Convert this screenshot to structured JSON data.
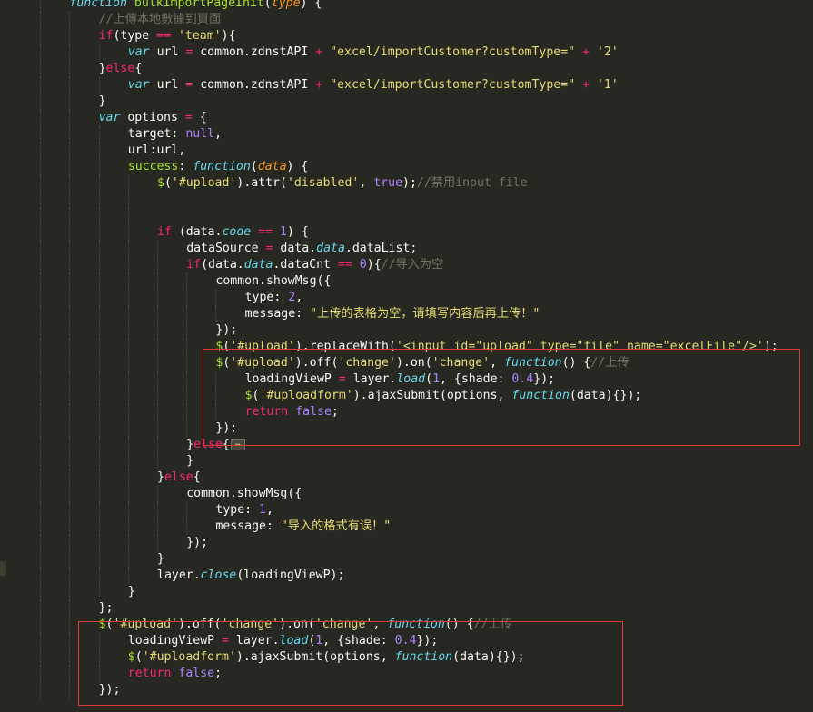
{
  "editor": {
    "theme": "Monokai",
    "colors": {
      "background": "#272822",
      "keyword": "#f92672",
      "storage": "#66d9ef",
      "function_name": "#a6e22e",
      "string": "#e6db74",
      "number": "#ae81ff",
      "comment": "#75715e",
      "parameter": "#fd971f",
      "text": "#f8f8f2",
      "highlight_box": "#d93a3a"
    },
    "lines": [
      {
        "indent": 2,
        "tokens": [
          [
            "st",
            "function"
          ],
          [
            "pl",
            " "
          ],
          [
            "fn",
            "bulkImportPageInit"
          ],
          [
            "pl",
            "("
          ],
          [
            "par",
            "type"
          ],
          [
            "pl",
            ") {"
          ]
        ]
      },
      {
        "indent": 3,
        "tokens": [
          [
            "cm",
            "//上傳本地數據到頁面"
          ]
        ]
      },
      {
        "indent": 3,
        "tokens": [
          [
            "kw",
            "if"
          ],
          [
            "pl",
            "(type "
          ],
          [
            "kw",
            "=="
          ],
          [
            "pl",
            " "
          ],
          [
            "str",
            "'team'"
          ],
          [
            "pl",
            "){"
          ]
        ]
      },
      {
        "indent": 4,
        "tokens": [
          [
            "st",
            "var"
          ],
          [
            "pl",
            " url "
          ],
          [
            "kw",
            "="
          ],
          [
            "pl",
            " common.zdnstAPI "
          ],
          [
            "kw",
            "+"
          ],
          [
            "pl",
            " "
          ],
          [
            "str",
            "\"excel/importCustomer?customType=\""
          ],
          [
            "pl",
            " "
          ],
          [
            "kw",
            "+"
          ],
          [
            "pl",
            " "
          ],
          [
            "str",
            "'2'"
          ]
        ]
      },
      {
        "indent": 3,
        "tokens": [
          [
            "pl",
            "}"
          ],
          [
            "kw",
            "else"
          ],
          [
            "pl",
            "{"
          ]
        ]
      },
      {
        "indent": 4,
        "tokens": [
          [
            "st",
            "var"
          ],
          [
            "pl",
            " url "
          ],
          [
            "kw",
            "="
          ],
          [
            "pl",
            " common.zdnstAPI "
          ],
          [
            "kw",
            "+"
          ],
          [
            "pl",
            " "
          ],
          [
            "str",
            "\"excel/importCustomer?customType=\""
          ],
          [
            "pl",
            " "
          ],
          [
            "kw",
            "+"
          ],
          [
            "pl",
            " "
          ],
          [
            "str",
            "'1'"
          ]
        ]
      },
      {
        "indent": 3,
        "tokens": [
          [
            "pl",
            "}"
          ]
        ]
      },
      {
        "indent": 3,
        "tokens": [
          [
            "st",
            "var"
          ],
          [
            "pl",
            " options "
          ],
          [
            "kw",
            "="
          ],
          [
            "pl",
            " {"
          ]
        ]
      },
      {
        "indent": 4,
        "tokens": [
          [
            "pl",
            "target: "
          ],
          [
            "num",
            "null"
          ],
          [
            "pl",
            ","
          ]
        ]
      },
      {
        "indent": 4,
        "tokens": [
          [
            "pl",
            "url:url,"
          ]
        ]
      },
      {
        "indent": 4,
        "tokens": [
          [
            "fn",
            "success"
          ],
          [
            "pl",
            ": "
          ],
          [
            "st",
            "function"
          ],
          [
            "pl",
            "("
          ],
          [
            "par",
            "data"
          ],
          [
            "pl",
            ") {"
          ]
        ]
      },
      {
        "indent": 5,
        "tokens": [
          [
            "fn",
            "$"
          ],
          [
            "pl",
            "("
          ],
          [
            "str",
            "'#upload'"
          ],
          [
            "pl",
            ").attr("
          ],
          [
            "str",
            "'disabled'"
          ],
          [
            "pl",
            ", "
          ],
          [
            "num",
            "true"
          ],
          [
            "pl",
            ");"
          ],
          [
            "cm",
            "//禁用input file"
          ]
        ]
      },
      {
        "indent": 5,
        "tokens": []
      },
      {
        "indent": 5,
        "tokens": []
      },
      {
        "indent": 5,
        "tokens": [
          [
            "kw",
            "if"
          ],
          [
            "pl",
            " (data."
          ],
          [
            "st",
            "code"
          ],
          [
            "pl",
            " "
          ],
          [
            "kw",
            "=="
          ],
          [
            "pl",
            " "
          ],
          [
            "num",
            "1"
          ],
          [
            "pl",
            ") {"
          ]
        ]
      },
      {
        "indent": 6,
        "tokens": [
          [
            "pl",
            "dataSource "
          ],
          [
            "kw",
            "="
          ],
          [
            "pl",
            " data."
          ],
          [
            "st",
            "data"
          ],
          [
            "pl",
            ".dataList;"
          ]
        ]
      },
      {
        "indent": 6,
        "tokens": [
          [
            "kw",
            "if"
          ],
          [
            "pl",
            "(data."
          ],
          [
            "st",
            "data"
          ],
          [
            "pl",
            ".dataCnt "
          ],
          [
            "kw",
            "=="
          ],
          [
            "pl",
            " "
          ],
          [
            "num",
            "0"
          ],
          [
            "pl",
            "){"
          ],
          [
            "cm",
            "//导入为空"
          ]
        ]
      },
      {
        "indent": 7,
        "tokens": [
          [
            "pl",
            "common.showMsg({"
          ]
        ]
      },
      {
        "indent": 8,
        "tokens": [
          [
            "pl",
            "type: "
          ],
          [
            "num",
            "2"
          ],
          [
            "pl",
            ","
          ]
        ]
      },
      {
        "indent": 8,
        "tokens": [
          [
            "pl",
            "message: "
          ],
          [
            "str",
            "\"上传的表格为空，请填写内容后再上传！\""
          ]
        ]
      },
      {
        "indent": 7,
        "tokens": [
          [
            "pl",
            "});"
          ]
        ]
      },
      {
        "indent": 7,
        "tokens": [
          [
            "fn",
            "$"
          ],
          [
            "pl",
            "("
          ],
          [
            "str",
            "'#upload'"
          ],
          [
            "pl",
            ").replaceWith("
          ],
          [
            "str",
            "'<input id=\"upload\" type=\"file\" name=\"excelFile\"/>'"
          ],
          [
            "pl",
            ");"
          ]
        ]
      },
      {
        "indent": 7,
        "tokens": [
          [
            "fn",
            "$"
          ],
          [
            "pl",
            "("
          ],
          [
            "str",
            "'#upload'"
          ],
          [
            "pl",
            ").off("
          ],
          [
            "str",
            "'change'"
          ],
          [
            "pl",
            ").on("
          ],
          [
            "str",
            "'change'"
          ],
          [
            "pl",
            ", "
          ],
          [
            "st",
            "function"
          ],
          [
            "pl",
            "() {"
          ],
          [
            "cm",
            "//上传"
          ]
        ]
      },
      {
        "indent": 8,
        "tokens": [
          [
            "pl",
            "loadingViewP "
          ],
          [
            "kw",
            "="
          ],
          [
            "pl",
            " layer."
          ],
          [
            "st",
            "load"
          ],
          [
            "pl",
            "("
          ],
          [
            "num",
            "1"
          ],
          [
            "pl",
            ", {shade: "
          ],
          [
            "num",
            "0.4"
          ],
          [
            "pl",
            "});"
          ]
        ]
      },
      {
        "indent": 8,
        "tokens": [
          [
            "fn",
            "$"
          ],
          [
            "pl",
            "("
          ],
          [
            "str",
            "'#uploadform'"
          ],
          [
            "pl",
            ").ajaxSubmit(options, "
          ],
          [
            "st",
            "function"
          ],
          [
            "pl",
            "(data){});"
          ]
        ]
      },
      {
        "indent": 8,
        "tokens": [
          [
            "kw",
            "return"
          ],
          [
            "pl",
            " "
          ],
          [
            "num",
            "false"
          ],
          [
            "pl",
            ";"
          ]
        ]
      },
      {
        "indent": 7,
        "tokens": [
          [
            "pl",
            "});"
          ]
        ]
      },
      {
        "indent": 6,
        "tokens": [
          [
            "pl",
            "}"
          ],
          [
            "kw",
            "else"
          ],
          [
            "pl",
            "{"
          ]
        ],
        "fold": true
      },
      {
        "indent": 6,
        "tokens": [
          [
            "pl",
            "}"
          ]
        ]
      },
      {
        "indent": 5,
        "tokens": [
          [
            "pl",
            "}"
          ],
          [
            "kw",
            "else"
          ],
          [
            "pl",
            "{"
          ]
        ]
      },
      {
        "indent": 6,
        "tokens": [
          [
            "pl",
            "common.showMsg({"
          ]
        ]
      },
      {
        "indent": 7,
        "tokens": [
          [
            "pl",
            "type: "
          ],
          [
            "num",
            "1"
          ],
          [
            "pl",
            ","
          ]
        ]
      },
      {
        "indent": 7,
        "tokens": [
          [
            "pl",
            "message: "
          ],
          [
            "str",
            "\"导入的格式有误！\""
          ]
        ]
      },
      {
        "indent": 6,
        "tokens": [
          [
            "pl",
            "});"
          ]
        ]
      },
      {
        "indent": 5,
        "tokens": [
          [
            "pl",
            "}"
          ]
        ]
      },
      {
        "indent": 5,
        "tokens": [
          [
            "pl",
            "layer."
          ],
          [
            "st",
            "close"
          ],
          [
            "pl",
            "(loadingViewP);"
          ]
        ]
      },
      {
        "indent": 4,
        "tokens": [
          [
            "pl",
            "}"
          ]
        ]
      },
      {
        "indent": 3,
        "tokens": [
          [
            "pl",
            "};"
          ]
        ]
      },
      {
        "indent": 3,
        "tokens": [
          [
            "fn",
            "$"
          ],
          [
            "pl",
            "("
          ],
          [
            "str",
            "'#upload'"
          ],
          [
            "pl",
            ").off("
          ],
          [
            "str",
            "'change'"
          ],
          [
            "pl",
            ").on("
          ],
          [
            "str",
            "'change'"
          ],
          [
            "pl",
            ", "
          ],
          [
            "st",
            "function"
          ],
          [
            "pl",
            "() {"
          ],
          [
            "cm",
            "//上传"
          ]
        ]
      },
      {
        "indent": 4,
        "tokens": [
          [
            "pl",
            "loadingViewP "
          ],
          [
            "kw",
            "="
          ],
          [
            "pl",
            " layer."
          ],
          [
            "st",
            "load"
          ],
          [
            "pl",
            "("
          ],
          [
            "num",
            "1"
          ],
          [
            "pl",
            ", {shade: "
          ],
          [
            "num",
            "0.4"
          ],
          [
            "pl",
            "});"
          ]
        ]
      },
      {
        "indent": 4,
        "tokens": [
          [
            "fn",
            "$"
          ],
          [
            "pl",
            "("
          ],
          [
            "str",
            "'#uploadform'"
          ],
          [
            "pl",
            ").ajaxSubmit(options, "
          ],
          [
            "st",
            "function"
          ],
          [
            "pl",
            "(data){});"
          ]
        ]
      },
      {
        "indent": 4,
        "tokens": [
          [
            "kw",
            "return"
          ],
          [
            "pl",
            " "
          ],
          [
            "num",
            "false"
          ],
          [
            "pl",
            ";"
          ]
        ]
      },
      {
        "indent": 3,
        "tokens": [
          [
            "pl",
            "});"
          ]
        ]
      }
    ]
  }
}
